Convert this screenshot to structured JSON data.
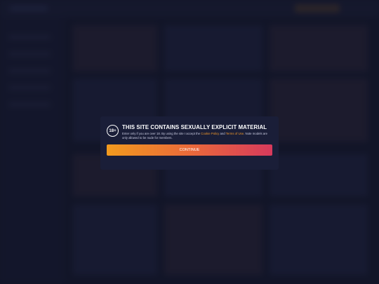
{
  "modal": {
    "badge": "18+",
    "title": "THIS SITE CONTAINS SEXUALLY EXPLICIT MATERIAL",
    "text_part1": "Enter only if you are over 18. By using the site I accept the ",
    "cookie_link": "Cookie Policy",
    "text_and": " and ",
    "terms_link": "Terms of Use",
    "text_part2": ". Note models are only allowed to be nude for members.",
    "continue_label": "CONTINUE"
  },
  "colors": {
    "background": "#161a2e",
    "modal": "#1a1e38",
    "link": "#f39a2b",
    "gradient_start": "#f29a1e",
    "gradient_end": "#d73a5c"
  }
}
